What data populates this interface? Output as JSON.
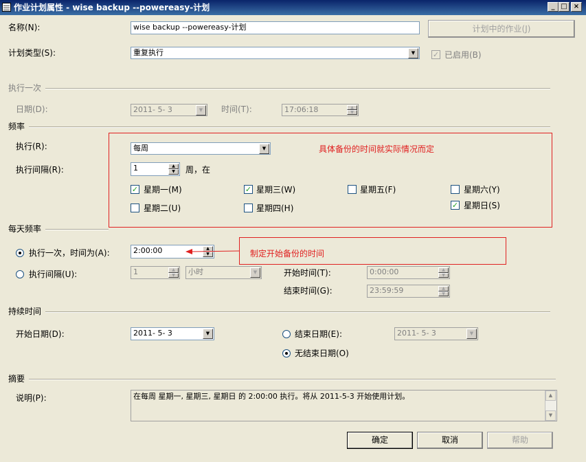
{
  "window": {
    "title": "作业计划属性 - wise backup --powereasy-计划",
    "minimize": "_",
    "maximize": "□",
    "close": "×"
  },
  "general": {
    "name_label": "名称(N):",
    "name_value": "wise backup --powereasy-计划",
    "jobs_button": "计划中的作业(J)",
    "type_label": "计划类型(S):",
    "type_value": "重复执行",
    "enabled_label": "已启用(B)"
  },
  "once": {
    "header": "执行一次",
    "date_label": "日期(D):",
    "date_value": "2011- 5- 3",
    "time_label": "时间(T):",
    "time_value": "17:06:18"
  },
  "frequency": {
    "header": "频率",
    "occurs_label": "执行(R):",
    "occurs_value": "每周",
    "interval_label": "执行间隔(R):",
    "interval_value": "1",
    "interval_unit": "周，在",
    "days": [
      {
        "label": "星期一(M)",
        "checked": true
      },
      {
        "label": "星期三(W)",
        "checked": true
      },
      {
        "label": "星期五(F)",
        "checked": false
      },
      {
        "label": "星期六(Y)",
        "checked": false
      },
      {
        "label": "星期二(U)",
        "checked": false
      },
      {
        "label": "星期四(H)",
        "checked": false
      },
      {
        "label": "星期日(S)",
        "checked": true
      }
    ]
  },
  "daily": {
    "header": "每天频率",
    "once_label": "执行一次，时间为(A):",
    "once_value": "2:00:00",
    "every_label": "执行间隔(U):",
    "every_value": "1",
    "every_unit": "小时",
    "start_label": "开始时间(T):",
    "start_value": "0:00:00",
    "end_label": "结束时间(G):",
    "end_value": "23:59:59"
  },
  "duration": {
    "header": "持续时间",
    "start_label": "开始日期(D):",
    "start_value": "2011- 5- 3",
    "end_label": "结束日期(E):",
    "end_value": "2011- 5- 3",
    "no_end_label": "无结束日期(O)"
  },
  "summary": {
    "header": "摘要",
    "desc_label": "说明(P):",
    "desc_value": "在每周 星期一, 星期三, 星期日 的 2:00:00 执行。将从 2011-5-3 开始使用计划。"
  },
  "buttons": {
    "ok": "确定",
    "cancel": "取消",
    "help": "帮助"
  },
  "annotations": {
    "note1": "具体备份的时间就实际情况而定",
    "note2": "制定开始备份的时间"
  }
}
